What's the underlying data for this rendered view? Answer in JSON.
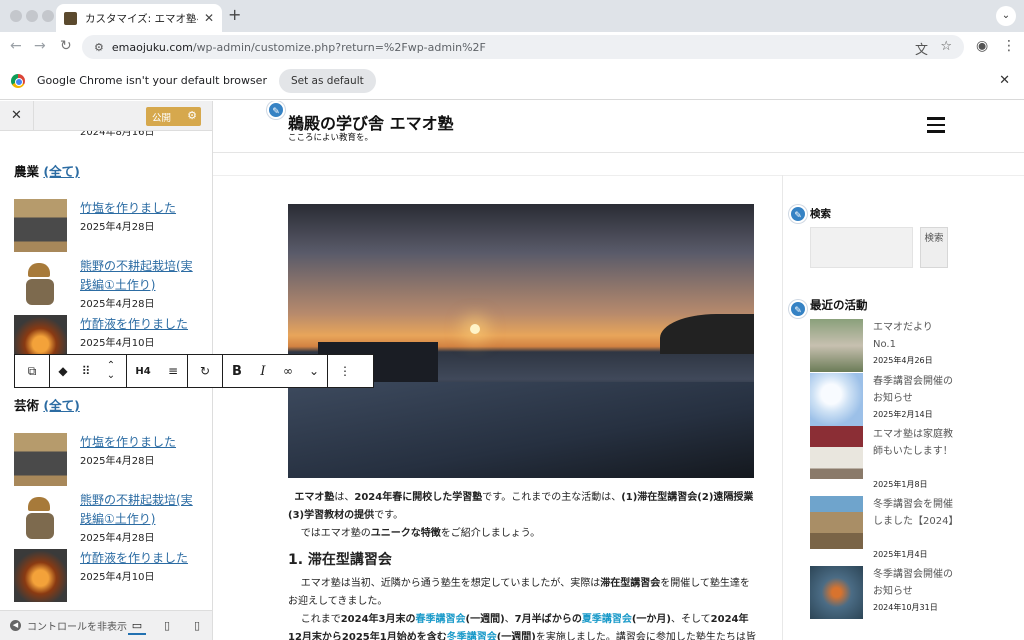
{
  "browser": {
    "tab_title": "カスタマイズ: エマオ塾へようこ",
    "url_host": "emaojuku.com",
    "url_path": "/wp-admin/customize.php?return=%2Fwp-admin%2F",
    "infobar_text": "Google Chrome isn't your default browser",
    "infobar_button": "Set as default"
  },
  "customizer": {
    "publish_label": "公開",
    "top_date": "2024年8月16日",
    "footer_label": "コントロールを非表示",
    "categories": [
      {
        "name": "農業",
        "all_link": "(全て)",
        "posts": [
          {
            "title": "竹塩を作りました",
            "date": "2025年4月28日",
            "thumb": "boxwood"
          },
          {
            "title": "熊野の不耕起栽培(実践編①土作り)",
            "date": "2025年4月28日",
            "thumb": "farmer"
          },
          {
            "title": "竹酢液を作りました",
            "date": "2025年4月10日",
            "thumb": "fire"
          }
        ]
      },
      {
        "name": "芸術",
        "all_link": "(全て)",
        "posts": [
          {
            "title": "竹塩を作りました",
            "date": "2025年4月28日",
            "thumb": "boxwood"
          },
          {
            "title": "熊野の不耕起栽培(実践編①土作り)",
            "date": "2025年4月28日",
            "thumb": "farmer"
          },
          {
            "title": "竹酢液を作りました",
            "date": "2025年4月10日",
            "thumb": "fire"
          }
        ]
      }
    ]
  },
  "block_toolbar": {
    "heading_level": "H4",
    "icons": [
      "transform-icon",
      "bookmark-icon",
      "drag-handle-icon",
      "move-up-down-icon",
      "align-icon",
      "link-loop-icon",
      "bold-icon",
      "italic-icon",
      "link-icon",
      "chevron-down-icon",
      "more-options-icon"
    ]
  },
  "site": {
    "title": "鵜殿の学び舎 エマオ塾",
    "tagline": "こころによい教育を。",
    "intro_p1_a": "エマオ塾",
    "intro_p1_b": "は、",
    "intro_p1_c": "2024年春に開校した学習塾",
    "intro_p1_d": "です。これまでの主な活動は、",
    "intro_p1_e": "(1)滞在型講習会(2)遠隔授業(3)学習教材の提供",
    "intro_p1_f": "です。",
    "intro_p2_a": "では",
    "intro_p2_b": "エマオ塾の",
    "intro_p2_c": "ユニークな特徴",
    "intro_p2_d": "をご紹介しましょう。",
    "section_heading": "1. 滞在型講習会",
    "sec_p1_a": "エマオ塾は当初、近隣から通う塾生を想定していましたが、実際は",
    "sec_p1_b": "滞在型講習会",
    "sec_p1_c": "を開催して塾生達をお迎えしてきました。",
    "sec_p2_a": "これまで",
    "sec_p2_b": "2024年3月末の",
    "sec_p2_c": "春季講習会",
    "sec_p2_d": "(一週間)",
    "sec_p2_e": "、",
    "sec_p2_f": "7月半ばからの",
    "sec_p2_g": "夏季講習会",
    "sec_p2_h": "(一か月)",
    "sec_p2_i": "、そして",
    "sec_p2_j": "2024年12月末から2025年1月始めを含む",
    "sec_p2_k": "冬季講習会",
    "sec_p2_l": "(一週間)",
    "sec_p2_m": "を実施しました。講習会に参加した塾生たちは皆遠方か"
  },
  "sidebar": {
    "search_title": "検索",
    "search_button": "検索",
    "recent_title": "最近の活動",
    "recent_posts": [
      {
        "title": "エマオだよりNo.1",
        "date": "2025年4月26日",
        "thumb": "gnome"
      },
      {
        "title": "春季講習会開催のお知らせ",
        "date": "2025年2月14日",
        "thumb": "blossom"
      },
      {
        "title": "エマオ塾は家庭教師もいたします！",
        "date": "2025年1月8日",
        "thumb": "book"
      },
      {
        "title": "冬季講習会を開催しました【2024】",
        "date": "2025年1月4日",
        "thumb": "field"
      },
      {
        "title": "冬季講習会開催のお知らせ",
        "date": "2024年10月31日",
        "thumb": "autumn"
      }
    ]
  }
}
